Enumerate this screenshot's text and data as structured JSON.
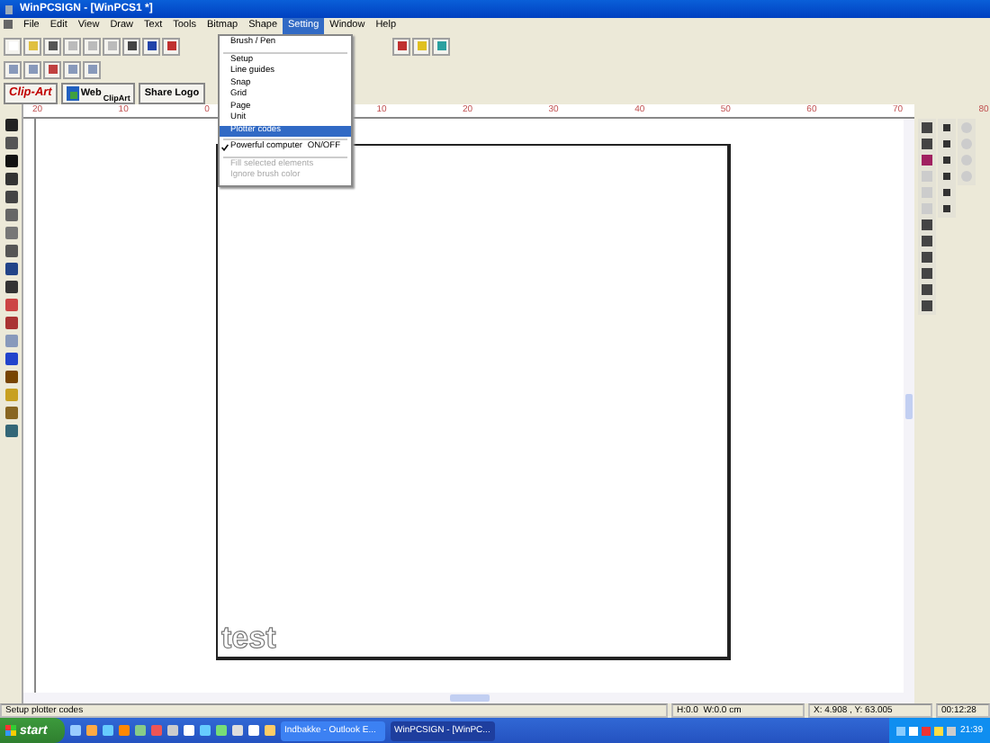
{
  "window": {
    "title": "WinPCSIGN - [WinPCS1 *]"
  },
  "menu": [
    {
      "label": "File",
      "selected": false
    },
    {
      "label": "Edit",
      "selected": false
    },
    {
      "label": "View",
      "selected": false
    },
    {
      "label": "Draw",
      "selected": false
    },
    {
      "label": "Text",
      "selected": false
    },
    {
      "label": "Tools",
      "selected": false
    },
    {
      "label": "Bitmap",
      "selected": false
    },
    {
      "label": "Shape",
      "selected": false
    },
    {
      "label": "Setting",
      "selected": true
    },
    {
      "label": "Window",
      "selected": false
    },
    {
      "label": "Help",
      "selected": false
    }
  ],
  "setting_menu": [
    {
      "kind": "item",
      "label": "Brush / Pen",
      "selected": false,
      "disabled": false
    },
    {
      "kind": "separator"
    },
    {
      "kind": "item",
      "label": "Setup",
      "selected": false,
      "disabled": false
    },
    {
      "kind": "item",
      "label": "Line guides",
      "selected": false,
      "disabled": false
    },
    {
      "kind": "item",
      "label": "Snap",
      "selected": false,
      "disabled": false
    },
    {
      "kind": "item",
      "label": "Grid",
      "selected": false,
      "disabled": false
    },
    {
      "kind": "item",
      "label": "Page",
      "selected": false,
      "disabled": false
    },
    {
      "kind": "item",
      "label": "Unit",
      "selected": false,
      "disabled": false
    },
    {
      "kind": "item",
      "label": "Plotter codes",
      "selected": true,
      "disabled": false
    },
    {
      "kind": "separator"
    },
    {
      "kind": "check",
      "label": "Powerful computer",
      "shortcut": "ON/OFF",
      "checked": true,
      "selected": false,
      "disabled": false
    },
    {
      "kind": "separator"
    },
    {
      "kind": "item",
      "label": "Fill selected elements",
      "selected": false,
      "disabled": true
    },
    {
      "kind": "item",
      "label": "Ignore brush color",
      "selected": false,
      "disabled": true
    }
  ],
  "clipart_bar": [
    {
      "kind": "clipart",
      "label": "Clip-Art"
    },
    {
      "kind": "web",
      "label": "Web",
      "sublabel": "ClipArt"
    },
    {
      "kind": "plain",
      "label": "Share Logo"
    }
  ],
  "ruler": {
    "labels": [
      "20",
      "10",
      "0",
      "10",
      "20",
      "30",
      "40",
      "50",
      "60",
      "70",
      "80"
    ]
  },
  "canvas": {
    "text": "test"
  },
  "status_bar": [
    "Setup plotter codes",
    "H:0.0  W:0.0 cm",
    "X: 4.908 , Y: 63.005",
    "00:12:28"
  ],
  "taskbar": {
    "start": "start",
    "tasks": [
      {
        "label": "Indbakke - Outlook E...",
        "selected": false
      },
      {
        "label": "WinPCSIGN - [WinPC...",
        "selected": true
      }
    ],
    "clock": "21:39"
  }
}
